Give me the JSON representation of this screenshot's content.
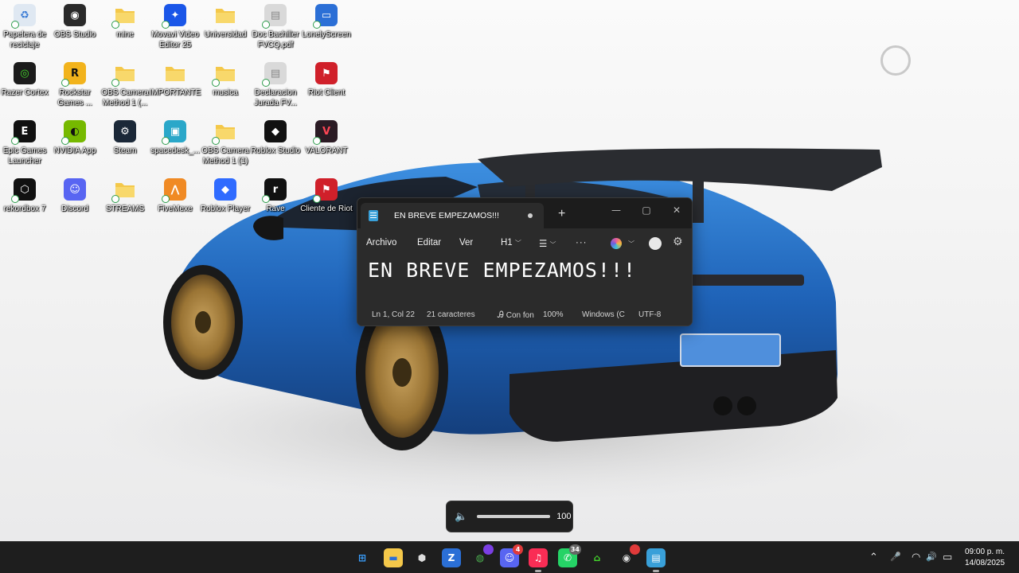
{
  "desktop": {
    "icons": [
      {
        "label": "Papelera de reciclaje",
        "icon": "recycle-bin-icon",
        "color": "#dfe8f2",
        "glyph": "♻",
        "glyph_color": "#3a7bd5"
      },
      {
        "label": "OBS Studio",
        "icon": "obs-icon",
        "color": "#2a2a2a",
        "glyph": "◉"
      },
      {
        "label": "mine",
        "icon": "folder-icon",
        "color": "#f4c84a",
        "glyph": ""
      },
      {
        "label": "Movavi Video Editor 25",
        "icon": "movavi-icon",
        "color": "#1a56e8",
        "glyph": "✦"
      },
      {
        "label": "Universidad",
        "icon": "folder-icon",
        "color": "#f4c84a",
        "glyph": ""
      },
      {
        "label": "Doc Bachiller FVCQ.pdf",
        "icon": "pdf-file-icon",
        "color": "#d9d9d9",
        "glyph": "▤",
        "glyph_color": "#888"
      },
      {
        "label": "LonelyScreen",
        "icon": "lonelyscreen-icon",
        "color": "#2b6fd6",
        "glyph": "▭"
      },
      {
        "label": "Razer Cortex",
        "icon": "razer-cortex-icon",
        "color": "#1b1b1b",
        "glyph": "◎",
        "glyph_color": "#44d62c"
      },
      {
        "label": "Rockstar Games ...",
        "icon": "rockstar-icon",
        "color": "#f2b31c",
        "glyph": "R",
        "glyph_color": "#111"
      },
      {
        "label": "OBS Camera Method 1 (...",
        "icon": "folder-icon",
        "color": "#f4c84a",
        "glyph": ""
      },
      {
        "label": "IMPORTANTE",
        "icon": "folder-icon",
        "color": "#f4c84a",
        "glyph": ""
      },
      {
        "label": "musica",
        "icon": "folder-icon",
        "color": "#f4c84a",
        "glyph": ""
      },
      {
        "label": "Declaracion Jurada FV...",
        "icon": "document-file-icon",
        "color": "#d9d9d9",
        "glyph": "▤",
        "glyph_color": "#888"
      },
      {
        "label": "Riot Client",
        "icon": "riot-client-icon",
        "color": "#d0202a",
        "glyph": "⚑"
      },
      {
        "label": "Epic Games Launcher",
        "icon": "epic-games-icon",
        "color": "#111111",
        "glyph": "E"
      },
      {
        "label": "NVIDIA App",
        "icon": "nvidia-icon",
        "color": "#76b900",
        "glyph": "◐",
        "glyph_color": "#111"
      },
      {
        "label": "Steam",
        "icon": "steam-icon",
        "color": "#1b2838",
        "glyph": "⚙"
      },
      {
        "label": "spacedesk_...",
        "icon": "spacedesk-icon",
        "color": "#2aa7c9",
        "glyph": "▣"
      },
      {
        "label": "OBS Camera Method 1 (1)",
        "icon": "folder-icon",
        "color": "#f4c84a",
        "glyph": ""
      },
      {
        "label": "Roblox Studio",
        "icon": "roblox-studio-icon",
        "color": "#111111",
        "glyph": "◆"
      },
      {
        "label": "VALORANT",
        "icon": "valorant-icon",
        "color": "#2b1b24",
        "glyph": "V",
        "glyph_color": "#ff4655"
      },
      {
        "label": "rekordbox 7",
        "icon": "rekordbox-icon",
        "color": "#111111",
        "glyph": "⬡"
      },
      {
        "label": "Discord",
        "icon": "discord-icon",
        "color": "#5865f2",
        "glyph": "☺"
      },
      {
        "label": "STREAMS",
        "icon": "folder-icon",
        "color": "#f4c84a",
        "glyph": ""
      },
      {
        "label": "FiveMexe",
        "icon": "fivem-icon",
        "color": "#f08a24",
        "glyph": "⋀"
      },
      {
        "label": "Roblox Player",
        "icon": "roblox-player-icon",
        "color": "#2f6bff",
        "glyph": "◆"
      },
      {
        "label": "Rave",
        "icon": "rave-icon",
        "color": "#111111",
        "glyph": "r"
      },
      {
        "label": "Cliente de Riot",
        "icon": "riot-client-icon",
        "color": "#d0202a",
        "glyph": "⚑"
      }
    ]
  },
  "notepad": {
    "tab_title": "EN BREVE EMPEZAMOS!!!",
    "new_tab": "+",
    "window_controls": {
      "minimize": "—",
      "maximize": "▢",
      "close": "✕"
    },
    "menu": {
      "archivo": "Archivo",
      "editar": "Editar",
      "ver": "Ver",
      "heading": "H1",
      "more": "···"
    },
    "content": "EN BREVE EMPEZAMOS!!!",
    "status": {
      "position": "Ln 1, Col 22",
      "characters": "21 caracteres",
      "font": "Con fon",
      "zoom": "100%",
      "line_endings": "Windows (C",
      "encoding": "UTF-8"
    }
  },
  "volume": {
    "level": 100,
    "label": "100",
    "icon": "speaker-icon"
  },
  "taskbar": {
    "apps": [
      {
        "name": "start-button",
        "color": "#1e1e1e",
        "glyph": "⊞",
        "glyph_color": "#3aa0ff"
      },
      {
        "name": "file-explorer",
        "color": "#f4c84a",
        "glyph": "▬",
        "glyph_color": "#2b6fd6"
      },
      {
        "name": "app-cube",
        "color": "#1e1e1e",
        "glyph": "⬢",
        "glyph_color": "#ddd"
      },
      {
        "name": "app-blue-z",
        "color": "#2b6fd6",
        "glyph": "Z"
      },
      {
        "name": "chrome",
        "color": "#1e1e1e",
        "glyph": "◍",
        "glyph_color": "#4caf50",
        "badge": "",
        "badge_color": "#7b3fe4"
      },
      {
        "name": "discord",
        "color": "#5865f2",
        "glyph": "☺",
        "badge": "4"
      },
      {
        "name": "apple-music",
        "color": "#fa2d55",
        "glyph": "♫",
        "active": true
      },
      {
        "name": "whatsapp",
        "color": "#25d366",
        "glyph": "✆",
        "badge": "34",
        "badge_grey": true
      },
      {
        "name": "razer-synapse",
        "color": "#1e1e1e",
        "glyph": "⌂",
        "glyph_color": "#44d62c"
      },
      {
        "name": "obs",
        "color": "#1e1e1e",
        "glyph": "◉",
        "glyph_color": "#ddd",
        "badge": ""
      },
      {
        "name": "notepad",
        "color": "#39a0d9",
        "glyph": "▤",
        "active": true
      }
    ],
    "tray": {
      "chevron": "⌃",
      "mic": "🎤",
      "wifi": "◠",
      "speaker": "🔊",
      "battery": "▭"
    },
    "clock": {
      "time": "09:00 p. m.",
      "date": "14/08/2025"
    }
  }
}
